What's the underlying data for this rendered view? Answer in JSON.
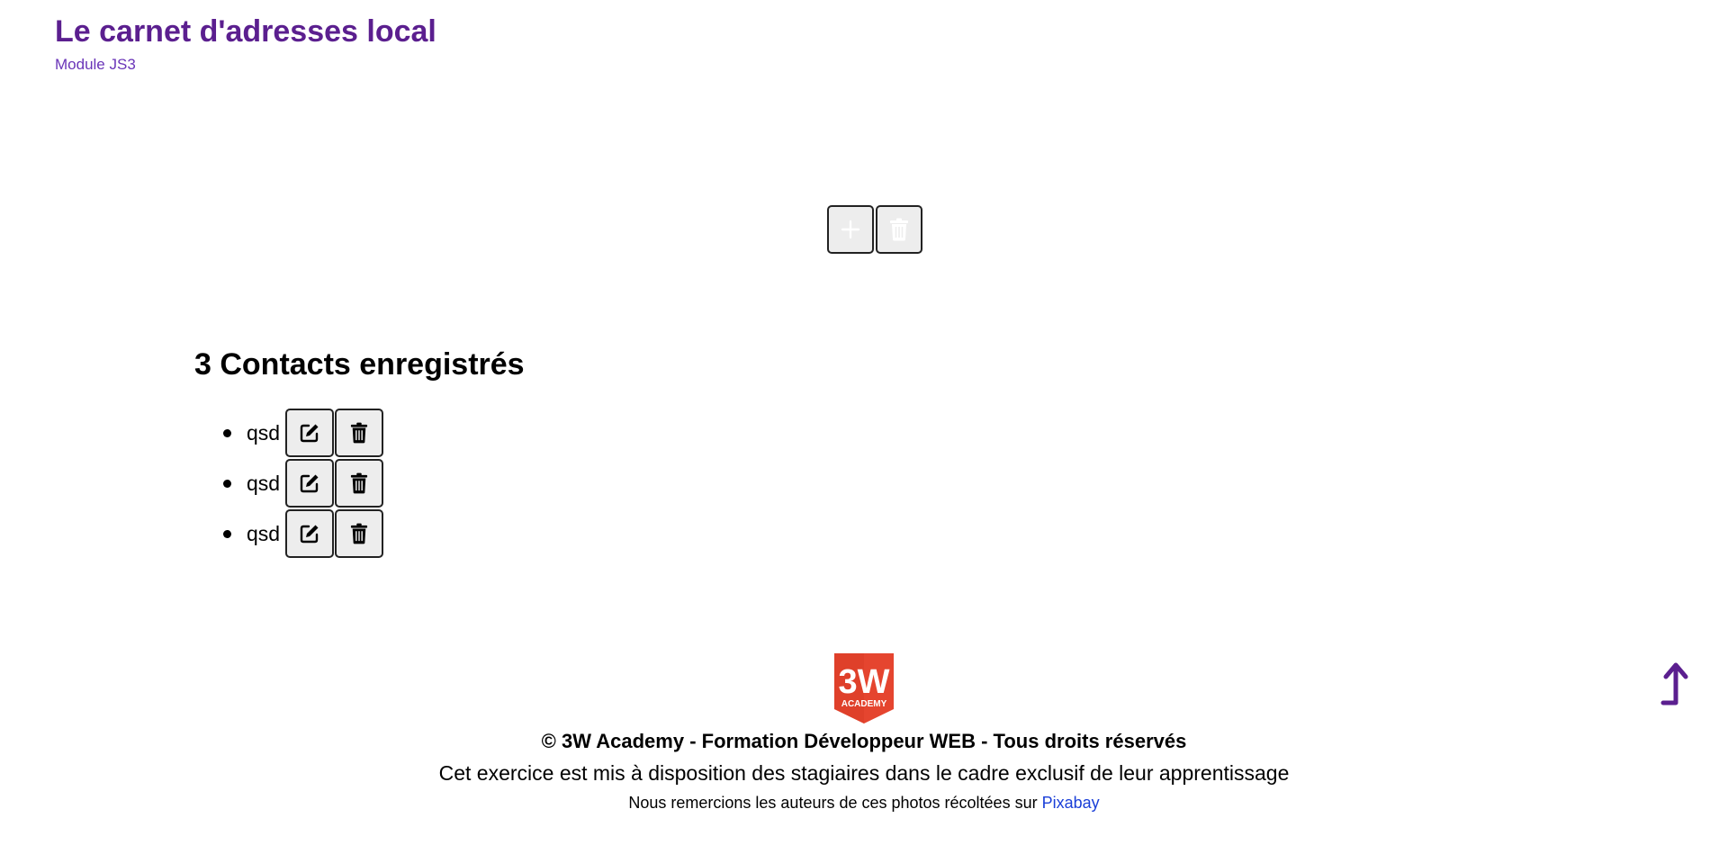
{
  "header": {
    "title": "Le carnet d'adresses local",
    "subtitle": "Module JS3"
  },
  "toolbar": {
    "add_icon": "plus-icon",
    "clear_icon": "trash-icon"
  },
  "contacts": {
    "heading": "3 Contacts enregistrés",
    "items": [
      {
        "name": "qsd",
        "edit_icon": "edit-icon",
        "delete_icon": "trash-icon"
      },
      {
        "name": "qsd",
        "edit_icon": "edit-icon",
        "delete_icon": "trash-icon"
      },
      {
        "name": "qsd",
        "edit_icon": "edit-icon",
        "delete_icon": "trash-icon"
      }
    ]
  },
  "footer": {
    "logo_text_main": "3W",
    "logo_text_sub": "ACADEMY",
    "copyright": "© 3W Academy - Formation Développeur WEB - Tous droits réservés",
    "notice": "Cet exercice est mis à disposition des stagiaires dans le cadre exclusif de leur apprentissage",
    "thanks_prefix": "Nous remercions les auteurs de ces photos récoltées sur ",
    "thanks_link": "Pixabay"
  },
  "scroll_top": {
    "icon": "arrow-up-icon"
  },
  "colors": {
    "title": "#5b1f8f",
    "subtitle": "#6a35b8",
    "link": "#1a3fd8",
    "logo_red": "#e5452f"
  }
}
